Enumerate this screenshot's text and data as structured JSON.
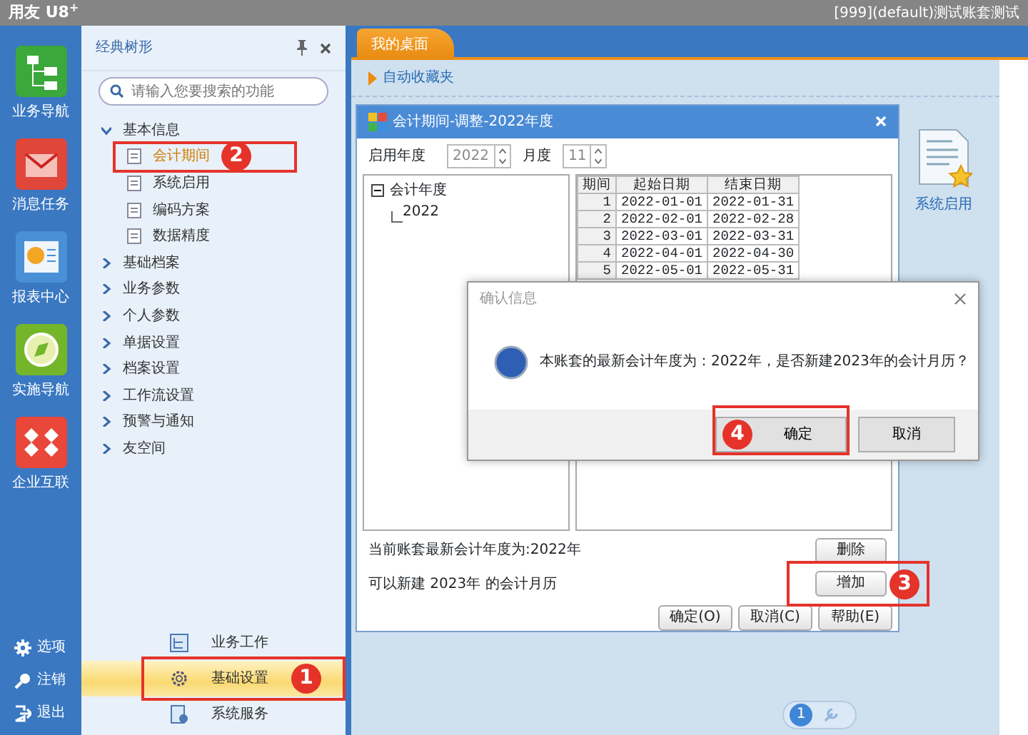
{
  "window": {
    "title": "用友 U8$^{+}$",
    "account": "[999](default)测试账套测试"
  },
  "nav_rail": {
    "items": [
      {
        "label": "业务导航",
        "kind": "tree"
      },
      {
        "label": "消息任务",
        "kind": "mail"
      },
      {
        "label": "报表中心",
        "kind": "report"
      },
      {
        "label": "实施导航",
        "kind": "compass"
      },
      {
        "label": "企业互联",
        "kind": "network"
      }
    ],
    "footer": [
      {
        "label": "选项",
        "kind": "gear"
      },
      {
        "label": "注销",
        "kind": "key"
      },
      {
        "label": "退出",
        "kind": "exit"
      }
    ]
  },
  "tree_panel": {
    "title": "经典树形",
    "search": {
      "placeholder": "请输入您要搜索的功能"
    },
    "items": [
      {
        "label": "基本信息",
        "expanded": true,
        "children": [
          {
            "label": "会计期间",
            "selected": true,
            "callout": "2"
          },
          {
            "label": "系统启用",
            "selected": false
          },
          {
            "label": "编码方案",
            "selected": false
          },
          {
            "label": "数据精度",
            "selected": false
          }
        ]
      },
      {
        "label": "基础档案",
        "expanded": false
      },
      {
        "label": "业务参数",
        "expanded": false
      },
      {
        "label": "个人参数",
        "expanded": false
      },
      {
        "label": "单据设置",
        "expanded": false
      },
      {
        "label": "档案设置",
        "expanded": false
      },
      {
        "label": "工作流设置",
        "expanded": false
      },
      {
        "label": "预警与通知",
        "expanded": false
      },
      {
        "label": "友空间",
        "expanded": false
      }
    ],
    "modules": [
      {
        "label": "业务工作",
        "selected": false,
        "kind": "work"
      },
      {
        "label": "基础设置",
        "selected": true,
        "kind": "gear",
        "callout": "1"
      },
      {
        "label": "系统服务",
        "selected": false,
        "kind": "service"
      }
    ]
  },
  "tabs": [
    {
      "label": "我的桌面",
      "selected": true
    }
  ],
  "favorites": {
    "label": "自动收藏夹"
  },
  "desktop_items": [
    {
      "label": "系统启用"
    }
  ],
  "period_dialog": {
    "title": "会计期间-调整-2022年度",
    "year_label": "启用年度",
    "year": "2022",
    "month_label": "月度",
    "month": "11",
    "tree": {
      "label": "会计年度",
      "expanded": true,
      "children": [
        {
          "label": "2022"
        }
      ]
    },
    "table": {
      "columns": [
        "期间",
        "起始日期",
        "结束日期"
      ],
      "rows": [
        [
          "1",
          "2022-01-01",
          "2022-01-31"
        ],
        [
          "2",
          "2022-02-01",
          "2022-02-28"
        ],
        [
          "3",
          "2022-03-01",
          "2022-03-31"
        ],
        [
          "4",
          "2022-04-01",
          "2022-04-30"
        ],
        [
          "5",
          "2022-05-01",
          "2022-05-31"
        ]
      ]
    },
    "latest_text": "当前账套最新会计年度为:2022年",
    "new_text": "可以新建 2023年 的会计月历",
    "side_buttons": [
      {
        "label": "删除"
      },
      {
        "label": "增加",
        "callout": "3"
      }
    ],
    "buttons": [
      {
        "label": "确定(O)"
      },
      {
        "label": "取消(C)"
      },
      {
        "label": "帮助(E)"
      }
    ]
  },
  "confirm_dialog": {
    "title": "确认信息",
    "message": "本账套的最新会计年度为：2022年，是否新建2023年的会计月历？",
    "buttons": [
      {
        "label": "确定",
        "callout": "4"
      },
      {
        "label": "取消"
      }
    ]
  },
  "pager": {
    "pages": [
      {
        "label": "1",
        "selected": true
      }
    ]
  }
}
